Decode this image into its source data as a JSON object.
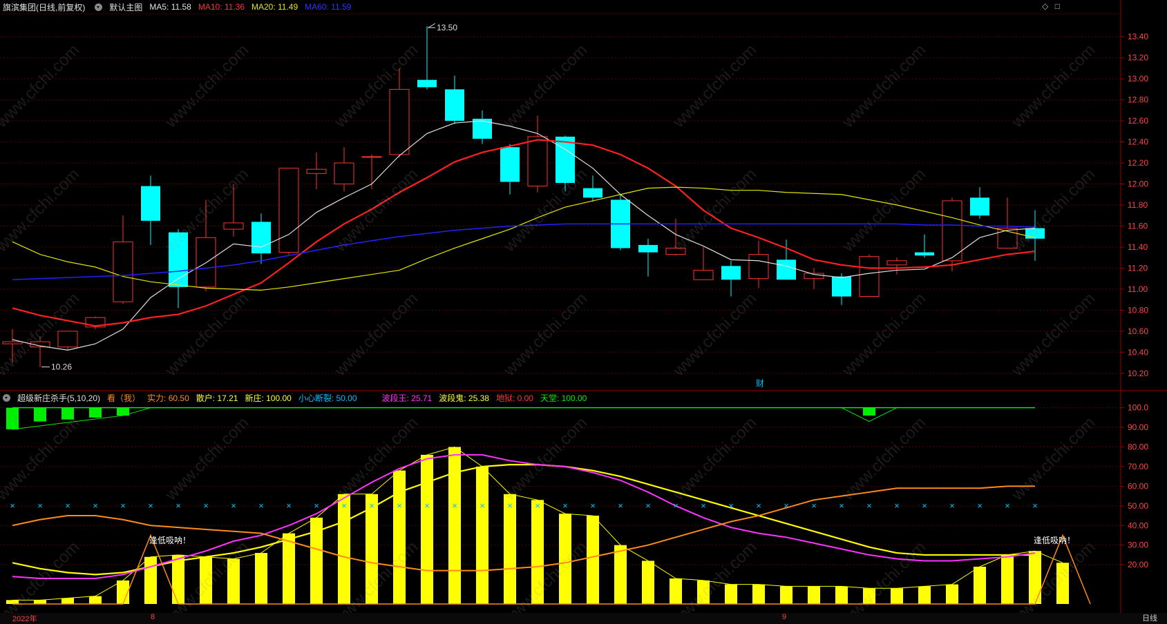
{
  "main_header": {
    "stock": "旗滨集团",
    "mode": "(日线,前复权)",
    "main_name": "默认主图",
    "ma5": "MA5: 11.58",
    "ma10": "MA10: 11.36",
    "ma20": "MA20: 11.49",
    "ma60": "MA60: 11.59"
  },
  "sub_header": {
    "name": "超级新庄杀手(5,10,20)",
    "kan": "看（我）",
    "shili": "实力: 60.50",
    "sanhu": "散户: 17.21",
    "xinzhuang": "新庄: 100.00",
    "xiaoxin": "小心断裂: 50.00",
    "boduanwang": "波段王: 25.71",
    "boduangui": "波段鬼: 25.38",
    "diyu": "地狱: 0.00",
    "tiantang": "天堂: 100.00"
  },
  "colors": {
    "up": "#ff3333",
    "down": "#00ffff",
    "ma5": "#e0e0e0",
    "ma10": "#ff2020",
    "ma20": "#e6e600",
    "ma60": "#2222ff",
    "grid": "#5a0000",
    "axis_text": "#ff4444",
    "bar": "#ffff00",
    "magenta": "#ff33ff",
    "orange": "#ff8c1a",
    "green": "#00ee00",
    "cross": "#00bfff"
  },
  "annotations": {
    "high": "13.50",
    "low": "10.26",
    "fin_marker": "财",
    "signal_left": "逢低吸呐！",
    "signal_right": "逢低吸呐！"
  },
  "x_labels": {
    "year": "2022年",
    "m8": "8",
    "m9": "9"
  },
  "period_button": "日线",
  "icons": [
    "diamond-icon",
    "square-icon",
    "dropdown-icon"
  ],
  "chart_data": [
    {
      "type": "candlestick",
      "title": "默认主图",
      "y_ticks": [
        "13.40",
        "13.20",
        "13.00",
        "12.80",
        "12.60",
        "12.40",
        "12.20",
        "12.00",
        "11.80",
        "11.60",
        "11.40",
        "11.20",
        "11.00",
        "10.80",
        "10.60",
        "10.40",
        "10.20"
      ],
      "ylim": [
        10.1,
        13.5
      ],
      "candles": [
        [
          10.48,
          10.5,
          10.3,
          10.62
        ],
        [
          10.45,
          10.5,
          10.26,
          10.55
        ],
        [
          10.45,
          10.6,
          10.42,
          10.6
        ],
        [
          10.64,
          10.73,
          10.62,
          10.74
        ],
        [
          10.88,
          11.45,
          10.86,
          11.7
        ],
        [
          11.98,
          11.65,
          11.42,
          12.08
        ],
        [
          11.54,
          11.02,
          10.82,
          11.57
        ],
        [
          11.02,
          11.49,
          10.98,
          11.85
        ],
        [
          11.57,
          11.63,
          11.5,
          12.0
        ],
        [
          11.64,
          11.34,
          11.24,
          11.72
        ],
        [
          11.35,
          12.15,
          11.33,
          12.15
        ],
        [
          12.1,
          12.14,
          11.95,
          12.3
        ],
        [
          12.0,
          12.2,
          11.93,
          12.35
        ],
        [
          12.26,
          12.26,
          11.95,
          12.28
        ],
        [
          12.28,
          12.9,
          12.25,
          13.1
        ],
        [
          12.99,
          12.92,
          12.9,
          13.5
        ],
        [
          12.9,
          12.6,
          12.57,
          13.03
        ],
        [
          12.62,
          12.43,
          12.38,
          12.7
        ],
        [
          12.35,
          12.02,
          11.9,
          12.38
        ],
        [
          11.98,
          12.45,
          11.92,
          12.65
        ],
        [
          12.45,
          12.01,
          11.93,
          12.46
        ],
        [
          11.96,
          11.87,
          11.83,
          12.08
        ],
        [
          11.85,
          11.39,
          11.37,
          11.9
        ],
        [
          11.42,
          11.35,
          11.12,
          11.48
        ],
        [
          11.33,
          11.39,
          11.32,
          11.67
        ],
        [
          11.09,
          11.18,
          11.09,
          11.4
        ],
        [
          11.22,
          11.09,
          10.93,
          11.27
        ],
        [
          11.1,
          11.33,
          11.01,
          11.46
        ],
        [
          11.28,
          11.09,
          11.09,
          11.47
        ],
        [
          11.1,
          11.15,
          11.0,
          11.2
        ],
        [
          11.12,
          10.93,
          10.85,
          11.15
        ],
        [
          10.93,
          11.31,
          10.93,
          11.33
        ],
        [
          11.23,
          11.27,
          11.14,
          11.3
        ],
        [
          11.35,
          11.32,
          11.3,
          11.52
        ],
        [
          11.27,
          11.84,
          11.17,
          11.87
        ],
        [
          11.87,
          11.7,
          11.67,
          11.97
        ],
        [
          11.39,
          11.58,
          11.39,
          11.87
        ],
        [
          11.58,
          11.48,
          11.27,
          11.75
        ]
      ],
      "series": [
        {
          "name": "MA5",
          "values": [
            10.52,
            10.46,
            10.42,
            10.48,
            10.62,
            10.92,
            11.1,
            11.25,
            11.43,
            11.4,
            11.52,
            11.73,
            11.87,
            12.0,
            12.27,
            12.48,
            12.58,
            12.6,
            12.55,
            12.48,
            12.33,
            12.15,
            11.9,
            11.7,
            11.52,
            11.41,
            11.28,
            11.27,
            11.22,
            11.14,
            11.11,
            11.15,
            11.18,
            11.19,
            11.3,
            11.49,
            11.56,
            11.58
          ]
        },
        {
          "name": "MA10",
          "values": [
            10.82,
            10.75,
            10.7,
            10.65,
            10.68,
            10.73,
            10.76,
            10.84,
            10.95,
            11.06,
            11.25,
            11.45,
            11.62,
            11.76,
            11.92,
            12.06,
            12.21,
            12.3,
            12.36,
            12.42,
            12.4,
            12.37,
            12.28,
            12.15,
            11.98,
            11.75,
            11.58,
            11.49,
            11.39,
            11.28,
            11.23,
            11.2,
            11.2,
            11.21,
            11.23,
            11.28,
            11.33,
            11.36
          ]
        },
        {
          "name": "MA20",
          "values": [
            11.45,
            11.33,
            11.26,
            11.21,
            11.12,
            11.07,
            11.04,
            11.01,
            11.0,
            10.99,
            11.02,
            11.06,
            11.1,
            11.14,
            11.18,
            11.29,
            11.39,
            11.48,
            11.57,
            11.68,
            11.78,
            11.84,
            11.9,
            11.96,
            11.97,
            11.96,
            11.94,
            11.94,
            11.92,
            11.91,
            11.9,
            11.85,
            11.8,
            11.74,
            11.68,
            11.61,
            11.55,
            11.49
          ]
        },
        {
          "name": "MA60",
          "values": [
            11.09,
            11.1,
            11.11,
            11.12,
            11.13,
            11.15,
            11.17,
            11.2,
            11.23,
            11.27,
            11.32,
            11.37,
            11.42,
            11.46,
            11.5,
            11.53,
            11.56,
            11.58,
            11.6,
            11.61,
            11.62,
            11.62,
            11.62,
            11.62,
            11.62,
            11.62,
            11.62,
            11.62,
            11.62,
            11.62,
            11.62,
            11.62,
            11.62,
            11.61,
            11.61,
            11.6,
            11.6,
            11.59
          ]
        }
      ]
    },
    {
      "type": "bar",
      "title": "超级新庄杀手(5,10,20)",
      "y_ticks": [
        "100.0",
        "90.00",
        "80.00",
        "70.00",
        "60.00",
        "50.00",
        "40.00",
        "30.00",
        "20.00"
      ],
      "ylim": [
        0,
        102
      ],
      "bars": [
        2,
        2,
        3,
        4,
        12,
        24,
        25,
        24,
        23,
        26,
        36,
        44,
        56,
        56,
        68,
        76,
        80,
        70,
        56,
        53,
        46,
        45,
        30,
        22,
        13,
        12,
        10,
        10,
        9,
        9,
        9,
        8,
        8,
        9,
        10,
        19,
        25,
        27,
        21
      ],
      "green_bars": [
        [
          89,
          100
        ],
        [
          93,
          100
        ],
        [
          94,
          100
        ],
        [
          95,
          100
        ],
        [
          96,
          100
        ],
        null,
        null,
        null,
        null,
        null,
        null,
        null,
        null,
        null,
        null,
        null,
        null,
        null,
        null,
        null,
        null,
        null,
        null,
        null,
        null,
        null,
        null,
        null,
        null,
        null,
        null,
        [
          96,
          100
        ],
        null,
        null,
        null,
        null,
        null,
        null,
        null
      ],
      "series": [
        {
          "name": "实力",
          "values": [
            21,
            18,
            16,
            15,
            16,
            19,
            22,
            24,
            26,
            29,
            33,
            37,
            42,
            49,
            57,
            62,
            67,
            70,
            71,
            71,
            70,
            68,
            65,
            61,
            57,
            53,
            49,
            45,
            41,
            37,
            33,
            29,
            26,
            25,
            25,
            25,
            25,
            25
          ]
        },
        {
          "name": "波段王",
          "values": [
            14,
            13,
            13,
            13,
            15,
            19,
            23,
            27,
            32,
            35,
            40,
            46,
            54,
            62,
            69,
            74,
            76,
            76,
            73,
            71,
            70,
            67,
            63,
            57,
            50,
            44,
            39,
            36,
            34,
            31,
            28,
            25,
            23,
            22,
            22,
            23,
            24,
            26
          ]
        },
        {
          "name": "散户",
          "values": [
            40,
            43,
            45,
            45,
            43,
            40,
            39,
            38,
            37,
            36,
            32,
            28,
            24,
            21,
            19,
            17,
            17,
            17,
            18,
            19,
            21,
            24,
            27,
            30,
            34,
            38,
            42,
            45,
            49,
            53,
            55,
            57,
            59,
            59,
            59,
            59,
            60,
            60
          ]
        },
        {
          "name": "天堂",
          "values": [
            100,
            100,
            100,
            100,
            100,
            100,
            100,
            100,
            100,
            100,
            100,
            100,
            100,
            100,
            100,
            100,
            100,
            100,
            100,
            100,
            100,
            100,
            100,
            100,
            100,
            100,
            100,
            100,
            100,
            100,
            100,
            100,
            100,
            100,
            100,
            100,
            100,
            100
          ]
        }
      ],
      "signal_line": [
        [
          0,
          0
        ],
        [
          4,
          0
        ],
        [
          5,
          35
        ],
        [
          6,
          0
        ],
        [
          37,
          0
        ],
        [
          38,
          35
        ],
        [
          39,
          0
        ]
      ],
      "cross_level": 50
    }
  ]
}
